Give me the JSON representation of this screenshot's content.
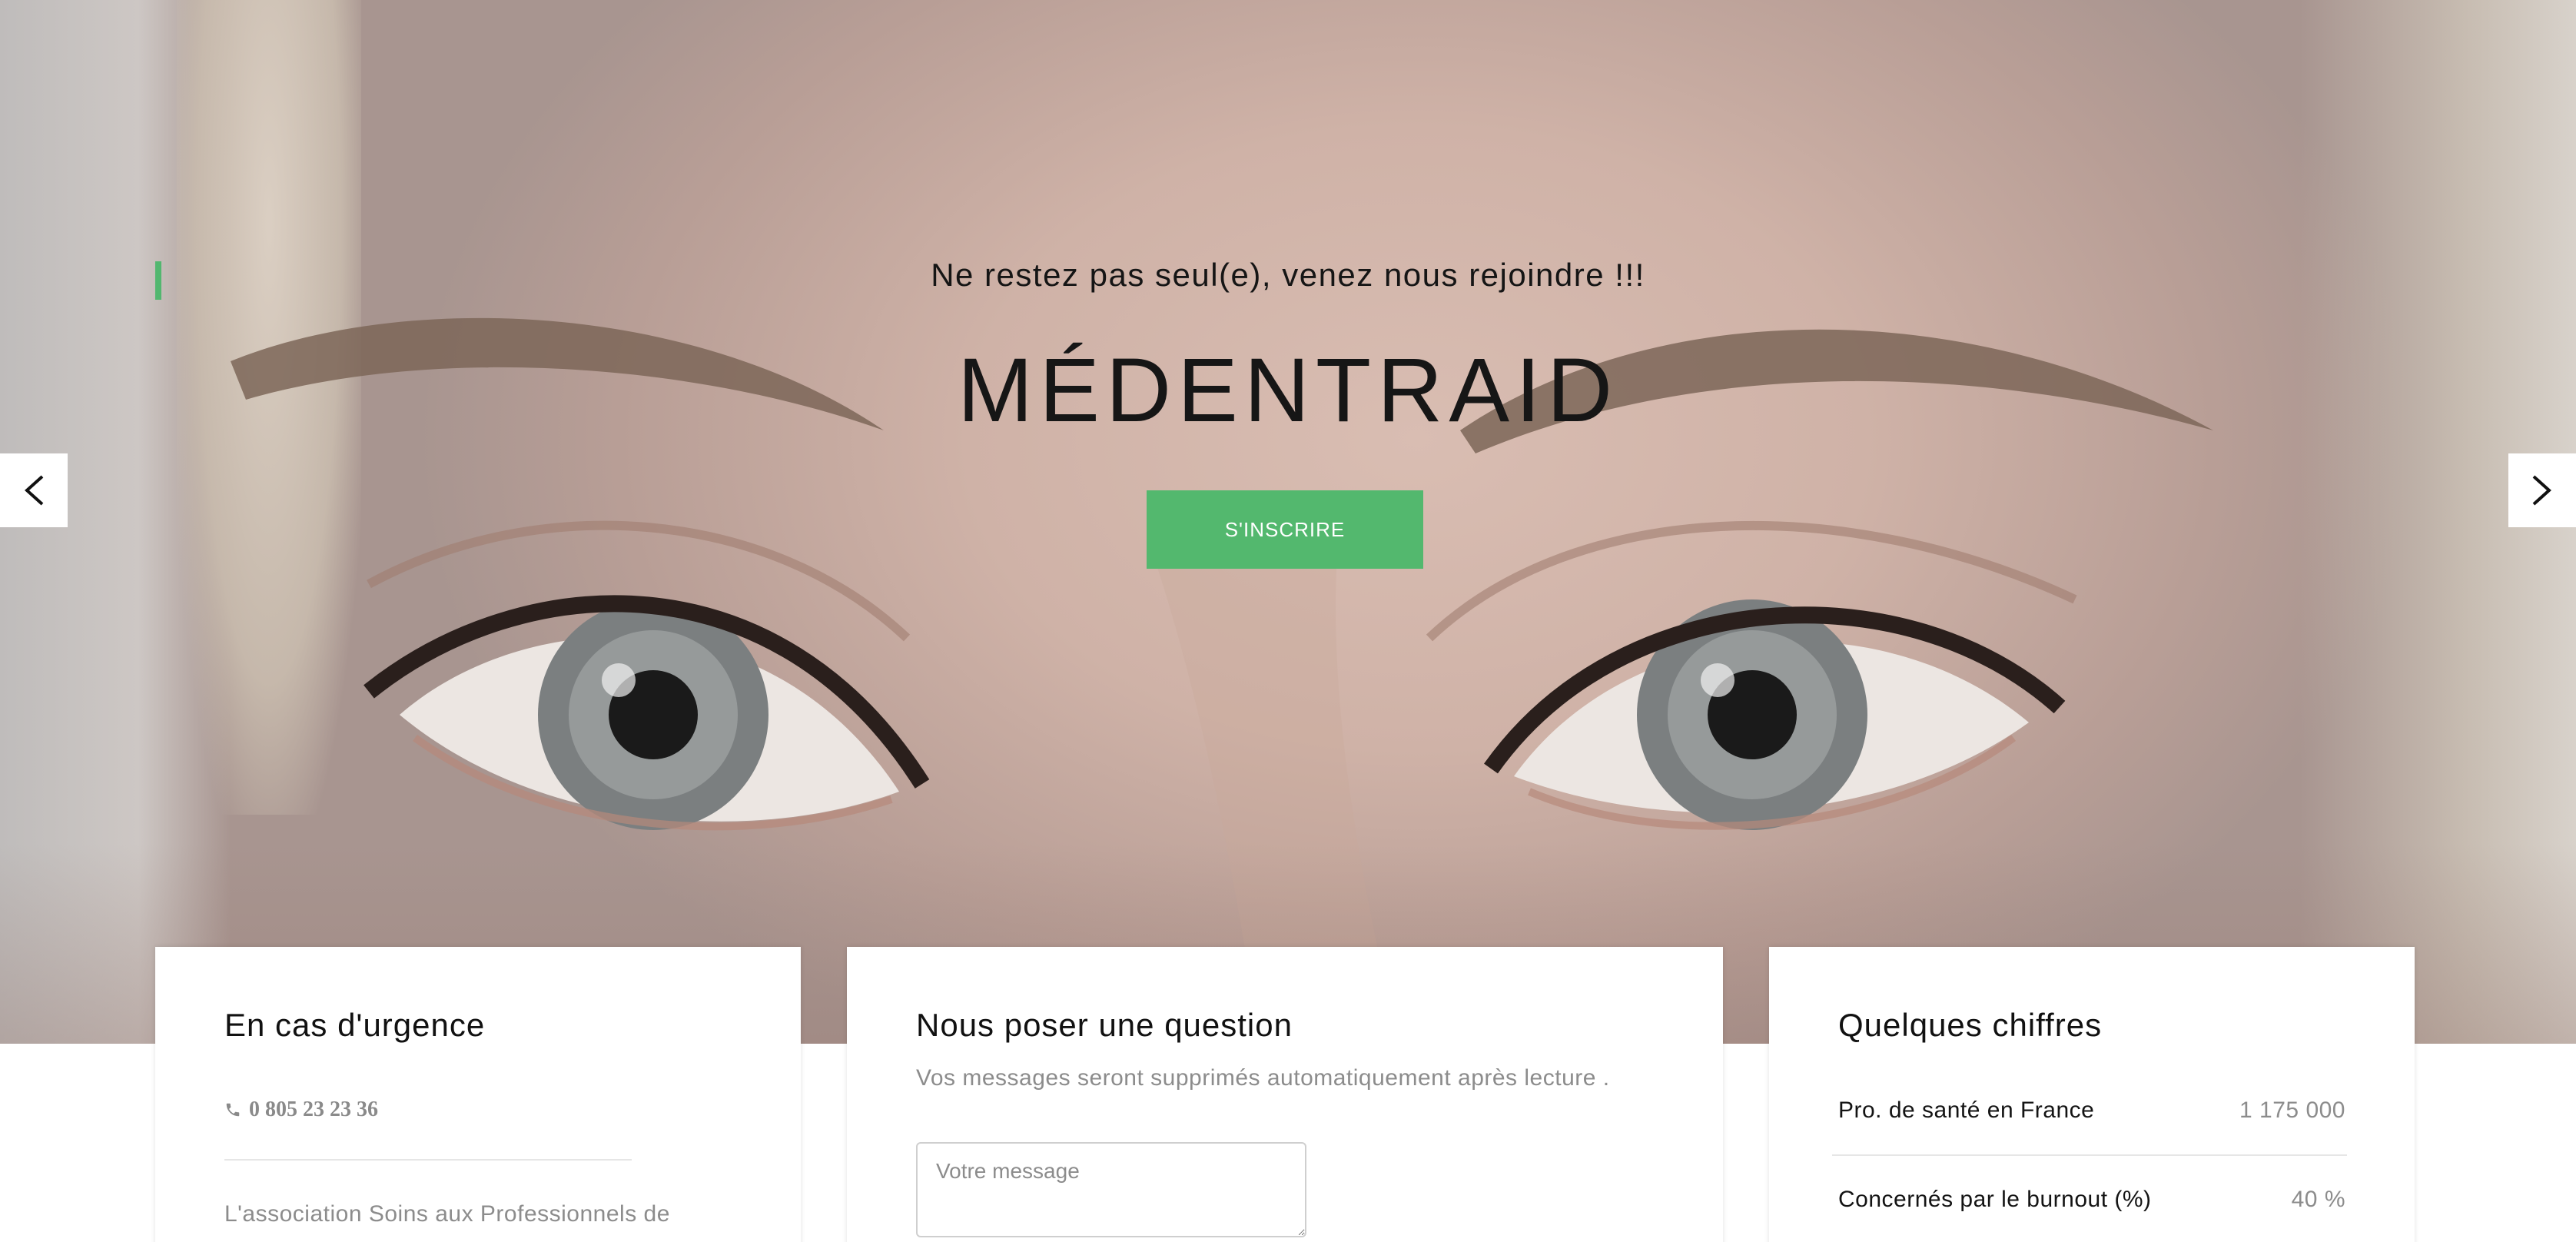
{
  "hero": {
    "tagline": "Ne restez pas seul(e), venez nous rejoindre !!!",
    "title": "MÉDENTRAID",
    "cta_label": "S'INSCRIRE",
    "accent_color": "#52b76f",
    "prev_icon": "chevron-left-icon",
    "next_icon": "chevron-right-icon"
  },
  "cards": {
    "emergency": {
      "title": "En cas d'urgence",
      "phone_icon": "phone-icon",
      "phone": "0 805 23 23 36",
      "description": "L'association Soins aux Professionnels de"
    },
    "question": {
      "title": "Nous poser une question",
      "subtitle": "Vos messages seront supprimés automatiquement après lecture .",
      "message_placeholder": "Votre message"
    },
    "figures": {
      "title": "Quelques chiffres",
      "rows": [
        {
          "label": "Pro. de santé en France",
          "value": "1 175 000"
        },
        {
          "label": "Concernés par le burnout (%)",
          "value": "40 %"
        }
      ]
    }
  }
}
